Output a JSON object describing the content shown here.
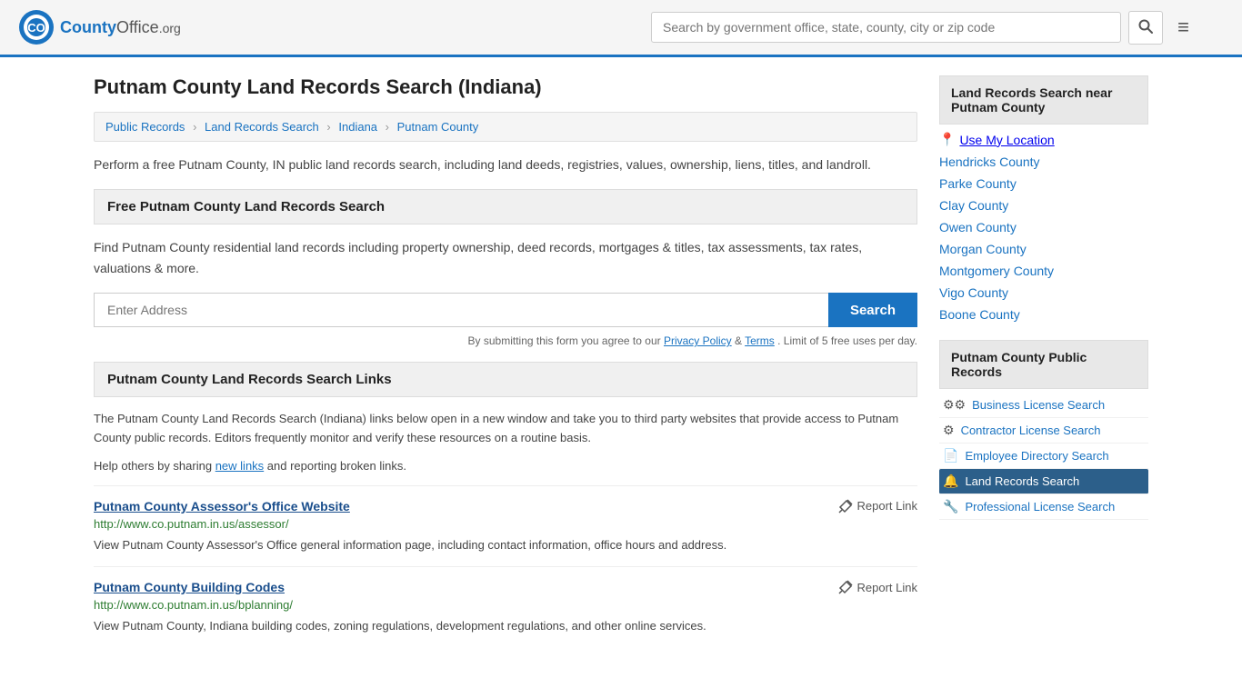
{
  "header": {
    "logo_text": "CountyOffice",
    "logo_org": ".org",
    "search_placeholder": "Search by government office, state, county, city or zip code",
    "menu_icon": "≡"
  },
  "page": {
    "title": "Putnam County Land Records Search (Indiana)",
    "breadcrumb": [
      {
        "label": "Public Records",
        "href": "#"
      },
      {
        "label": "Land Records Search",
        "href": "#"
      },
      {
        "label": "Indiana",
        "href": "#"
      },
      {
        "label": "Putnam County",
        "href": "#"
      }
    ],
    "description": "Perform a free Putnam County, IN public land records search, including land deeds, registries, values, ownership, liens, titles, and landroll.",
    "free_search_header": "Free Putnam County Land Records Search",
    "free_search_desc": "Find Putnam County residential land records including property ownership, deed records, mortgages & titles, tax assessments, tax rates, valuations & more.",
    "address_placeholder": "Enter Address",
    "search_btn": "Search",
    "form_terms": "By submitting this form you agree to our",
    "privacy_policy": "Privacy Policy",
    "and": "&",
    "terms": "Terms",
    "limit_text": ". Limit of 5 free uses per day.",
    "links_header": "Putnam County Land Records Search Links",
    "links_desc1": "The Putnam County Land Records Search (Indiana) links below open in a new window and take you to third party websites that provide access to Putnam County public records. Editors frequently monitor and verify these resources on a routine basis.",
    "links_desc2": "Help others by sharing",
    "new_links": "new links",
    "links_desc2_end": "and reporting broken links.",
    "links": [
      {
        "title": "Putnam County Assessor's Office Website",
        "url": "http://www.co.putnam.in.us/assessor/",
        "desc": "View Putnam County Assessor's Office general information page, including contact information, office hours and address.",
        "report": "Report Link"
      },
      {
        "title": "Putnam County Building Codes",
        "url": "http://www.co.putnam.in.us/bplanning/",
        "desc": "View Putnam County, Indiana building codes, zoning regulations, development regulations, and other online services.",
        "report": "Report Link"
      }
    ]
  },
  "sidebar": {
    "nearby_header": "Land Records Search near Putnam County",
    "use_location": "Use My Location",
    "nearby_counties": [
      "Hendricks County",
      "Parke County",
      "Clay County",
      "Owen County",
      "Morgan County",
      "Montgomery County",
      "Vigo County",
      "Boone County"
    ],
    "public_records_header": "Putnam County Public Records",
    "public_records_items": [
      {
        "label": "Business License Search",
        "icon": "gear",
        "active": false
      },
      {
        "label": "Contractor License Search",
        "icon": "gear",
        "active": false
      },
      {
        "label": "Employee Directory Search",
        "icon": "doc",
        "active": false
      },
      {
        "label": "Land Records Search",
        "icon": "bell",
        "active": true
      },
      {
        "label": "Professional License Search",
        "icon": "wrench",
        "active": false
      }
    ]
  }
}
